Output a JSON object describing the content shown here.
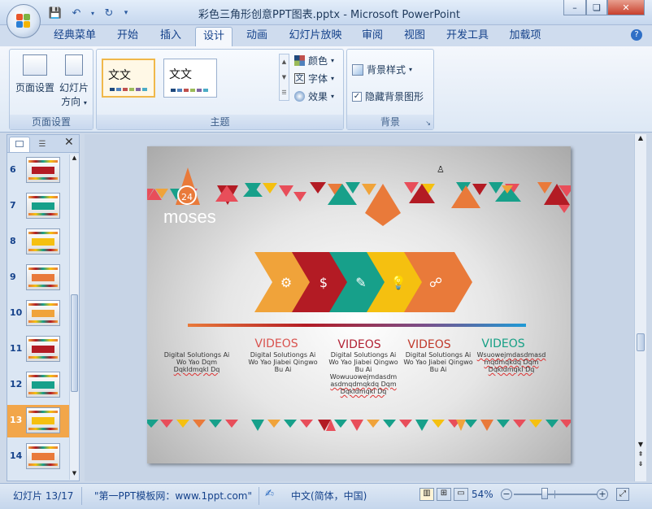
{
  "window": {
    "title": "彩色三角形创意PPT图表.pptx - Microsoft PowerPoint"
  },
  "tabs": [
    {
      "label": "经典菜单"
    },
    {
      "label": "开始"
    },
    {
      "label": "插入"
    },
    {
      "label": "设计"
    },
    {
      "label": "动画"
    },
    {
      "label": "幻灯片放映"
    },
    {
      "label": "审阅"
    },
    {
      "label": "视图"
    },
    {
      "label": "开发工具"
    },
    {
      "label": "加载项"
    }
  ],
  "ribbon": {
    "page_setup": {
      "group_label": "页面设置",
      "page_setup_label": "页面设置",
      "orientation_label": "幻灯片",
      "orientation_label2": "方向"
    },
    "themes": {
      "group_label": "主题",
      "theme1_text": "文文",
      "theme2_text": "文文",
      "colors_label": "颜色",
      "fonts_label": "字体",
      "effects_label": "效果"
    },
    "background": {
      "group_label": "背景",
      "styles_label": "背景样式",
      "hide_graphics_label": "隐藏背景图形",
      "hide_graphics_checked": true
    }
  },
  "slides_pane": {
    "items": [
      {
        "num": "6"
      },
      {
        "num": "7"
      },
      {
        "num": "8"
      },
      {
        "num": "9"
      },
      {
        "num": "10"
      },
      {
        "num": "11"
      },
      {
        "num": "12"
      },
      {
        "num": "13",
        "selected": true
      },
      {
        "num": "14"
      }
    ]
  },
  "slide": {
    "logo_text": "moses",
    "logo_badge": "24",
    "columns": [
      {
        "title": "VIDEOS",
        "color": "#d9534f",
        "text": ""
      },
      {
        "title": "VIDEOS",
        "color": "#b22234",
        "text": ""
      },
      {
        "title": "VIDEOS",
        "color": "#c0392b",
        "text": ""
      },
      {
        "title": "VIDEOS",
        "color": "#16a085",
        "text": ""
      }
    ],
    "desc": [
      {
        "lines": [
          "Digital Solutiongs Ai",
          "Wo Yao Dqm",
          "Dqkldmqkl Dq"
        ]
      },
      {
        "lines": [
          "Digital Solutiongs Ai",
          "Wo Yao Jiabei Qingwo",
          "Bu Ai"
        ]
      },
      {
        "lines": [
          "Digital Solutiongs Ai",
          "Wo Yao Jiabei Qingwo",
          "Bu Ai",
          "Wowuuowejmdasdm",
          "asdmqdmqkdq Dqm",
          "Dqkldmqkl Dq"
        ]
      },
      {
        "lines": [
          "Digital Solutiongs Ai",
          "Wo Yao Jiabei Qingwo",
          "Bu Ai"
        ]
      },
      {
        "lines": [
          "Wsuowejmdasdmasd",
          "mqdmqkdq Dqm",
          "Dqkldmqkl Dq"
        ]
      }
    ],
    "arrow_colors": [
      "#f0a33a",
      "#b31b24",
      "#17a08a",
      "#f5c010",
      "#e97a3a"
    ]
  },
  "status": {
    "slide_info": "幻灯片 13/17",
    "theme_name": "\"第一PPT模板网：www.1ppt.com\"",
    "language": "中文(简体，中国)",
    "zoom": "54%",
    "zoom_fraction": 0.54
  }
}
